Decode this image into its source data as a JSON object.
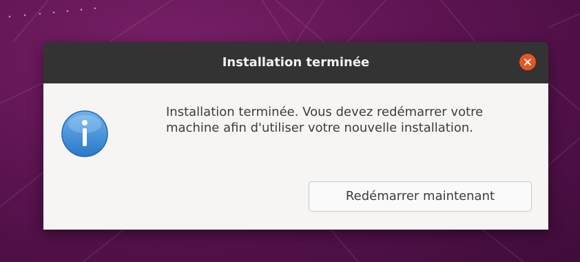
{
  "dialog": {
    "title": "Installation terminée",
    "message": "Installation terminée. Vous devez redémarrer votre machine afin d'utiliser votre nouvelle installation.",
    "primary_button_label": "Redémarrer maintenant",
    "icon": "info-icon",
    "close_icon": "close-icon"
  },
  "colors": {
    "desktop_background": "#5e1452",
    "titlebar": "#333333",
    "dialog_body": "#f6f5f4",
    "close_button": "#e95420",
    "info_icon": "#3b8fd8"
  }
}
